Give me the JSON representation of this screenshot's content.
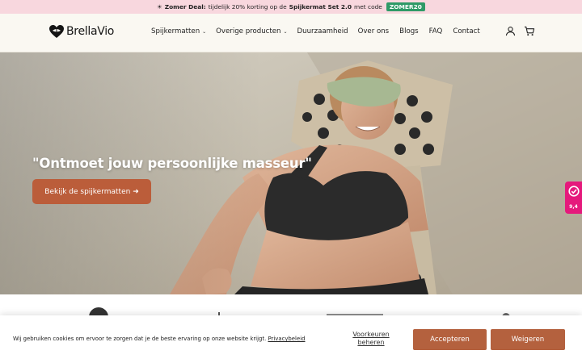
{
  "announcement": {
    "emoji": "☀",
    "deal_label": "Zomer Deal:",
    "text_before": "tijdelijk 20% korting op de",
    "product": "Spijkermat Set 2.0",
    "text_after": "met code",
    "code": "ZOMER20"
  },
  "header": {
    "logo_text": "BrellaVio",
    "nav": [
      {
        "label": "Spijkermatten",
        "dropdown": true
      },
      {
        "label": "Overige producten",
        "dropdown": true
      },
      {
        "label": "Duurzaamheid",
        "dropdown": false
      },
      {
        "label": "Over ons",
        "dropdown": false
      },
      {
        "label": "Blogs",
        "dropdown": false
      },
      {
        "label": "FAQ",
        "dropdown": false
      },
      {
        "label": "Contact",
        "dropdown": false
      }
    ],
    "icons": [
      "account-icon",
      "cart-icon"
    ]
  },
  "hero": {
    "title": "\"Ontmoet jouw persoonlijke masseur\"",
    "button_label": "Bekijk de spijkermatten ➜"
  },
  "review_badge": {
    "score": "9,4"
  },
  "cookie_banner": {
    "text": "Wij gebruiken cookies om ervoor te zorgen dat je de beste ervaring op onze website krijgt.",
    "link_label": "Privacybeleid",
    "preferences_label": "Voorkeuren beheren",
    "accept_label": "Accepteren",
    "reject_label": "Weigeren"
  },
  "colors": {
    "announcement_bg": "#f8d7de",
    "code_bg": "#2f9a67",
    "accent": "#bb5d3a",
    "badge": "#e5197c"
  }
}
